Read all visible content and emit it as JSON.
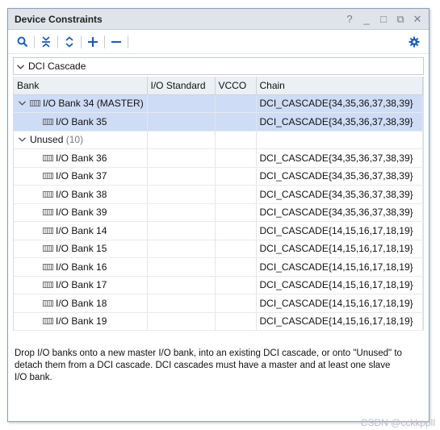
{
  "window": {
    "title": "Device Constraints",
    "controls": [
      "?",
      "_",
      "□",
      "⧉",
      "✕"
    ]
  },
  "toolbar": {
    "icons": [
      "search-icon",
      "collapse-all-icon",
      "expand-all-icon",
      "add-icon",
      "remove-icon",
      "gear-icon"
    ]
  },
  "filter": {
    "label": "DCI Cascade"
  },
  "table": {
    "columns": [
      "Bank",
      "I/O Standard",
      "VCCO",
      "Chain"
    ],
    "master": {
      "label": "I/O Bank 34 (MASTER)",
      "chain": "DCI_CASCADE{34,35,36,37,38,39}"
    },
    "slave": {
      "label": "I/O Bank 35",
      "chain": "DCI_CASCADE{34,35,36,37,38,39}"
    },
    "unused": {
      "label": "Unused",
      "count": "(10)"
    },
    "unused_rows": [
      {
        "label": "I/O Bank 36",
        "chain": "DCI_CASCADE{34,35,36,37,38,39}"
      },
      {
        "label": "I/O Bank 37",
        "chain": "DCI_CASCADE{34,35,36,37,38,39}"
      },
      {
        "label": "I/O Bank 38",
        "chain": "DCI_CASCADE{34,35,36,37,38,39}"
      },
      {
        "label": "I/O Bank 39",
        "chain": "DCI_CASCADE{34,35,36,37,38,39}"
      },
      {
        "label": "I/O Bank 14",
        "chain": "DCI_CASCADE{14,15,16,17,18,19}"
      },
      {
        "label": "I/O Bank 15",
        "chain": "DCI_CASCADE{14,15,16,17,18,19}"
      },
      {
        "label": "I/O Bank 16",
        "chain": "DCI_CASCADE{14,15,16,17,18,19}"
      },
      {
        "label": "I/O Bank 17",
        "chain": "DCI_CASCADE{14,15,16,17,18,19}"
      },
      {
        "label": "I/O Bank 18",
        "chain": "DCI_CASCADE{14,15,16,17,18,19}"
      },
      {
        "label": "I/O Bank 19",
        "chain": "DCI_CASCADE{14,15,16,17,18,19}"
      }
    ]
  },
  "hint": {
    "lines": [
      "Drop I/O banks onto a new master I/O bank, into an existing DCI cascade, or onto \"Unused\" to",
      "detach them from a DCI cascade. DCI cascades must have a master and at least one slave",
      "I/O bank."
    ]
  },
  "watermark": "CSDN @cckkppll",
  "colors": {
    "accent": "#1f5fb4",
    "selection": "#cfdcf6",
    "titlebar": "#dfe3ea"
  }
}
